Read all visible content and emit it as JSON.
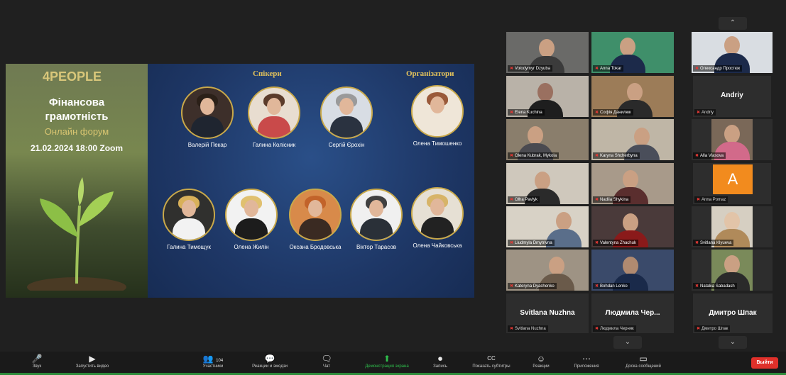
{
  "slide": {
    "brand": "4PEOPLE",
    "title_line1": "Фінансова",
    "title_line2": "грамотність",
    "subtitle": "Онлайн форум",
    "date": "21.02.2024 18:00 Zoom",
    "speakers_heading": "Спікери",
    "organizers_heading": "Організатори",
    "speakers": [
      {
        "name": "Валерій Пекар"
      },
      {
        "name": "Галина Колісник"
      },
      {
        "name": "Сергій Єрохін"
      },
      {
        "name": "Олена Тимошенко"
      },
      {
        "name": "Галина Тимощук"
      },
      {
        "name": "Олена Жилін"
      },
      {
        "name": "Оксана Бродовська"
      },
      {
        "name": "Віктор Тарасов"
      },
      {
        "name": "Олена Чайковська"
      }
    ]
  },
  "gallery": {
    "col1": [
      {
        "label": "Volodymyr Dzyuba"
      },
      {
        "label": "Elena Kuchina"
      },
      {
        "label": "Olena Kubrak, Mykola"
      },
      {
        "label": "Olha Pavlyk"
      },
      {
        "label": "Liudmyla Dmytrivna"
      },
      {
        "label": "Kateryna Dyachenko"
      }
    ],
    "col2": [
      {
        "label": "Anna Tokar"
      },
      {
        "label": "Софія Данилюк"
      },
      {
        "label": "Karyna Shcherbyna"
      },
      {
        "label": "Nadiia Shykina"
      },
      {
        "label": "Valentyna Zhachuk"
      },
      {
        "label": "Bohdan Lenko"
      }
    ],
    "col3": [
      {
        "label": "Олександр Простюк"
      },
      {
        "label": "Andriy"
      },
      {
        "label": "Alla Vlasova"
      },
      {
        "label": "Anna Pomaz"
      },
      {
        "label": "Svitlana Klyueva"
      },
      {
        "label": "Nataliia Sabadash"
      }
    ],
    "avatar_letter": "A",
    "name_tiles": [
      {
        "big": "Svitlana Nuzhna",
        "label": "Svitlana Nuzhna"
      },
      {
        "big": "Людмила Чер...",
        "label": "Людмила Черняк"
      },
      {
        "big": "Дмитро Шпак",
        "label": "Дмитро Шпак"
      }
    ],
    "andriy_big": "Andriy"
  },
  "toolbar": {
    "items": [
      {
        "icon": "🎤",
        "label": "Звук"
      },
      {
        "icon": "▶",
        "label": "Запустить видео"
      },
      {
        "icon": "👥",
        "label": "Участники"
      },
      {
        "icon": "💬",
        "label": "Реакции и эмодзи"
      },
      {
        "icon": "🗨",
        "label": "Чат"
      },
      {
        "icon": "⬆",
        "label": "Демонстрация экрана"
      },
      {
        "icon": "⏺",
        "label": "Запись"
      },
      {
        "icon": "CC",
        "label": "Показать субтитры"
      },
      {
        "icon": "☺",
        "label": "Реакции"
      },
      {
        "icon": "⋯",
        "label": "Приложения"
      },
      {
        "icon": "▭",
        "label": "Доска сообщений"
      }
    ],
    "participants_count": "104",
    "leave_label": "Выйти"
  },
  "colors": {
    "accent_green": "#2fbf4c",
    "leave_red": "#e0302a",
    "slide_blue": "#1e3766",
    "gold": "#e4c35b"
  }
}
